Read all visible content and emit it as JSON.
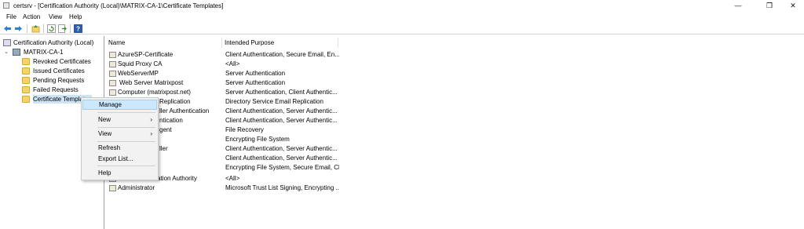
{
  "window": {
    "title": "certsrv - [Certification Authority (Local)\\MATRIX-CA-1\\Certificate Templates]",
    "minimize": "—",
    "restore": "❐",
    "close": "✕"
  },
  "menubar": {
    "items": [
      "File",
      "Action",
      "View",
      "Help"
    ]
  },
  "toolbar": {
    "buttons": [
      "back-icon",
      "forward-icon",
      "up-folder-icon",
      "refresh-icon",
      "export-list-icon",
      "help-icon"
    ]
  },
  "tree": {
    "root": "Certification Authority (Local)",
    "ca": "MATRIX-CA-1",
    "ca_expander": "⌄",
    "children": [
      "Revoked Certificates",
      "Issued Certificates",
      "Pending Requests",
      "Failed Requests",
      "Certificate Templates"
    ]
  },
  "list": {
    "columns": [
      "Name",
      "Intended Purpose"
    ],
    "rows": [
      {
        "name": "AzureSP-Certificate",
        "purpose": "Client Authentication, Secure Email, En..."
      },
      {
        "name": "Squid Proxy CA",
        "purpose": "<All>"
      },
      {
        "name": "WebServerMP",
        "purpose": "Server Authentication"
      },
      {
        "name": "Web Server Matrixpost",
        "purpose": "Server Authentication"
      },
      {
        "name": "Computer (matrixpost.net)",
        "purpose": "Server Authentication, Client Authentic..."
      },
      {
        "name": "Replication",
        "purpose": "Directory Service Email Replication"
      },
      {
        "name": "ller Authentication",
        "purpose": "Client Authentication, Server Authentic..."
      },
      {
        "name": "ntication",
        "purpose": "Client Authentication, Server Authentic..."
      },
      {
        "name": "gent",
        "purpose": "File Recovery"
      },
      {
        "name": "",
        "purpose": "Encrypting File System"
      },
      {
        "name": "ller",
        "purpose": "Client Authentication, Server Authentic..."
      },
      {
        "name": "",
        "purpose": "Client Authentication, Server Authentic..."
      },
      {
        "name": "",
        "purpose": "Encrypting File System, Secure Email, Cl..."
      },
      {
        "name": "ertification Authority",
        "purpose": "<All>"
      },
      {
        "name": "Administrator",
        "purpose": "Microsoft Trust List Signing, Encrypting ..."
      }
    ]
  },
  "context_menu": {
    "manage": "Manage",
    "new": "New",
    "view": "View",
    "refresh": "Refresh",
    "export_list": "Export List...",
    "help": "Help",
    "submenu_arrow": "›"
  }
}
